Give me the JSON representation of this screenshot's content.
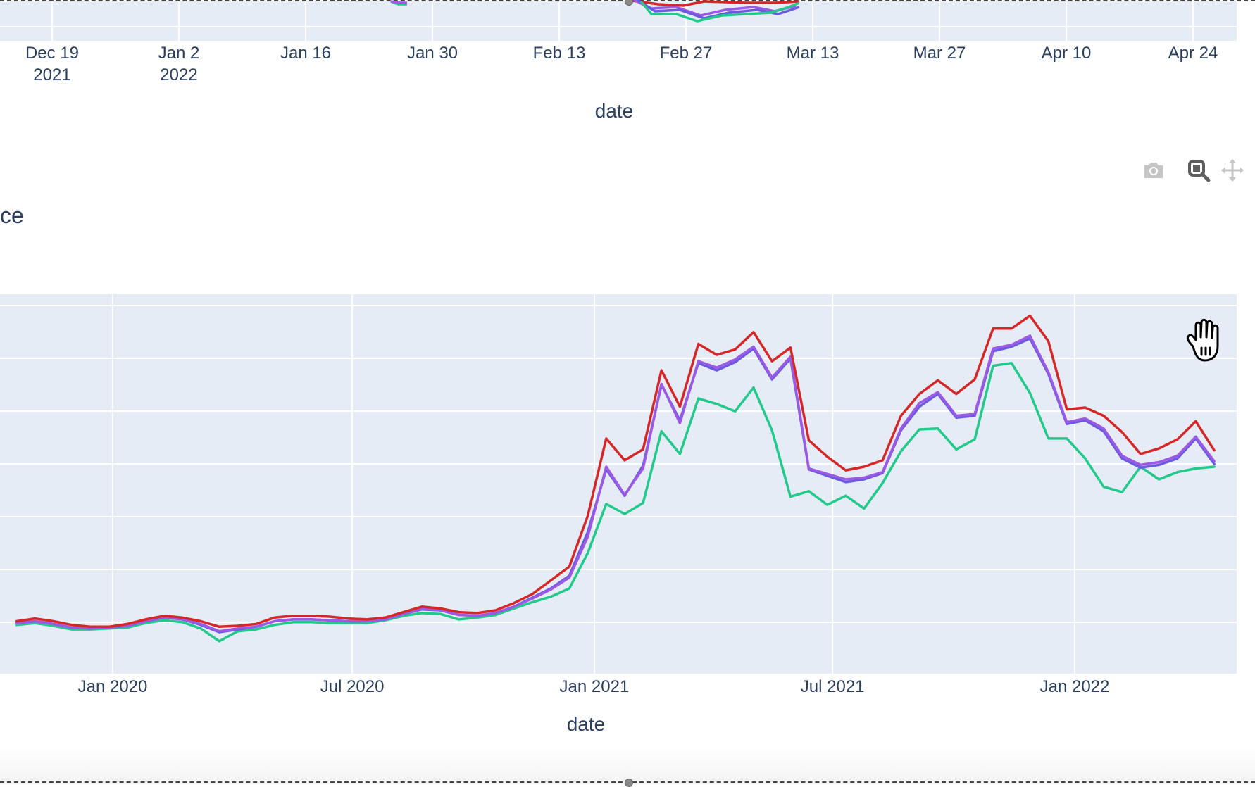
{
  "top_chart": {
    "xlabel": "date",
    "ticks": [
      "Dec 19\n2021",
      "Jan 2\n2022",
      "Jan 16",
      "Jan 30",
      "Feb 13",
      "Feb 27",
      "Mar 13",
      "Mar 27",
      "Apr 10",
      "Apr 24"
    ]
  },
  "modebar": {
    "camera": "camera-icon",
    "zoom": "zoom-icon",
    "pan": "pan-icon"
  },
  "main_chart": {
    "title_fragment": "ce",
    "xlabel": "date",
    "ticks": [
      "Jan 2020",
      "Jul 2020",
      "Jan 2021",
      "Jul 2021",
      "Jan 2022"
    ]
  },
  "chart_data": {
    "type": "line",
    "xlabel": "date",
    "x_axis_ticks": [
      "Jan 2020",
      "Jul 2020",
      "Jan 2021",
      "Jul 2021",
      "Jan 2022"
    ],
    "grid": true,
    "colors": [
      "#d62728",
      "#9b59e6",
      "#6a5ae0",
      "#22c98a"
    ],
    "x_dates": [
      "2019-10-20",
      "2019-11-03",
      "2019-11-17",
      "2019-12-01",
      "2019-12-15",
      "2019-12-29",
      "2020-01-12",
      "2020-01-26",
      "2020-02-09",
      "2020-02-23",
      "2020-03-08",
      "2020-03-22",
      "2020-04-05",
      "2020-04-19",
      "2020-05-03",
      "2020-05-17",
      "2020-05-31",
      "2020-06-14",
      "2020-06-28",
      "2020-07-12",
      "2020-07-26",
      "2020-08-09",
      "2020-08-23",
      "2020-09-06",
      "2020-09-20",
      "2020-10-04",
      "2020-10-18",
      "2020-11-01",
      "2020-11-15",
      "2020-11-29",
      "2020-12-13",
      "2020-12-27",
      "2021-01-10",
      "2021-01-24",
      "2021-02-07",
      "2021-02-21",
      "2021-03-07",
      "2021-03-21",
      "2021-04-04",
      "2021-04-18",
      "2021-05-02",
      "2021-05-16",
      "2021-05-30",
      "2021-06-13",
      "2021-06-27",
      "2021-07-11",
      "2021-07-25",
      "2021-08-08",
      "2021-08-22",
      "2021-09-05",
      "2021-09-19",
      "2021-10-03",
      "2021-10-17",
      "2021-10-31",
      "2021-11-14",
      "2021-11-28",
      "2021-12-12",
      "2021-12-26",
      "2022-01-09",
      "2022-01-23",
      "2022-02-06",
      "2022-02-20",
      "2022-03-06",
      "2022-03-20",
      "2022-04-03",
      "2022-04-17"
    ],
    "series": [
      {
        "values": [
          0.12,
          0.15,
          0.12,
          0.08,
          0.06,
          0.06,
          0.09,
          0.14,
          0.18,
          0.16,
          0.12,
          0.06,
          0.07,
          0.09,
          0.16,
          0.18,
          0.18,
          0.17,
          0.15,
          0.14,
          0.16,
          0.22,
          0.28,
          0.26,
          0.22,
          0.21,
          0.24,
          0.32,
          0.42,
          0.57,
          0.72,
          1.28,
          2.13,
          1.89,
          2.01,
          2.88,
          2.48,
          3.17,
          3.05,
          3.11,
          3.3,
          2.98,
          3.13,
          2.11,
          1.93,
          1.78,
          1.82,
          1.89,
          2.38,
          2.62,
          2.77,
          2.62,
          2.78,
          3.34,
          3.34,
          3.48,
          3.2,
          2.45,
          2.47,
          2.38,
          2.2,
          1.96,
          2.02,
          2.12,
          2.32,
          2.0
        ]
      },
      {
        "values": [
          0.1,
          0.12,
          0.09,
          0.05,
          0.04,
          0.05,
          0.07,
          0.12,
          0.16,
          0.14,
          0.09,
          0.01,
          0.04,
          0.06,
          0.12,
          0.14,
          0.14,
          0.13,
          0.12,
          0.12,
          0.14,
          0.2,
          0.26,
          0.24,
          0.19,
          0.18,
          0.21,
          0.28,
          0.37,
          0.47,
          0.6,
          1.05,
          1.82,
          1.51,
          1.8,
          2.73,
          2.3,
          2.98,
          2.91,
          3.0,
          3.14,
          2.8,
          3.03,
          1.8,
          1.74,
          1.68,
          1.7,
          1.76,
          2.24,
          2.52,
          2.64,
          2.38,
          2.4,
          3.12,
          3.16,
          3.26,
          2.86,
          2.31,
          2.35,
          2.24,
          1.94,
          1.84,
          1.87,
          1.94,
          2.15,
          1.88
        ]
      },
      {
        "values": [
          0.1,
          0.12,
          0.09,
          0.05,
          0.04,
          0.05,
          0.07,
          0.12,
          0.16,
          0.14,
          0.08,
          0.0,
          0.03,
          0.06,
          0.12,
          0.14,
          0.14,
          0.13,
          0.12,
          0.12,
          0.14,
          0.2,
          0.25,
          0.24,
          0.19,
          0.18,
          0.21,
          0.28,
          0.38,
          0.48,
          0.62,
          1.1,
          1.79,
          1.5,
          1.83,
          2.72,
          2.33,
          2.96,
          2.88,
          2.97,
          3.12,
          2.78,
          3.01,
          1.79,
          1.72,
          1.65,
          1.68,
          1.75,
          2.22,
          2.48,
          2.62,
          2.36,
          2.38,
          3.09,
          3.14,
          3.23,
          2.84,
          2.29,
          2.33,
          2.21,
          1.91,
          1.81,
          1.84,
          1.91,
          2.13,
          1.85
        ]
      },
      {
        "values": [
          0.08,
          0.1,
          0.07,
          0.03,
          0.03,
          0.04,
          0.05,
          0.1,
          0.13,
          0.11,
          0.04,
          -0.1,
          0.01,
          0.03,
          0.08,
          0.11,
          0.11,
          0.1,
          0.1,
          0.1,
          0.13,
          0.18,
          0.21,
          0.2,
          0.14,
          0.16,
          0.19,
          0.26,
          0.33,
          0.39,
          0.48,
          0.87,
          1.41,
          1.3,
          1.42,
          2.21,
          1.96,
          2.57,
          2.51,
          2.43,
          2.69,
          2.22,
          1.49,
          1.55,
          1.4,
          1.5,
          1.36,
          1.64,
          1.99,
          2.23,
          2.24,
          2.01,
          2.12,
          2.93,
          2.96,
          2.63,
          2.13,
          2.13,
          1.91,
          1.6,
          1.54,
          1.82,
          1.68,
          1.76,
          1.8,
          1.82
        ]
      }
    ]
  }
}
